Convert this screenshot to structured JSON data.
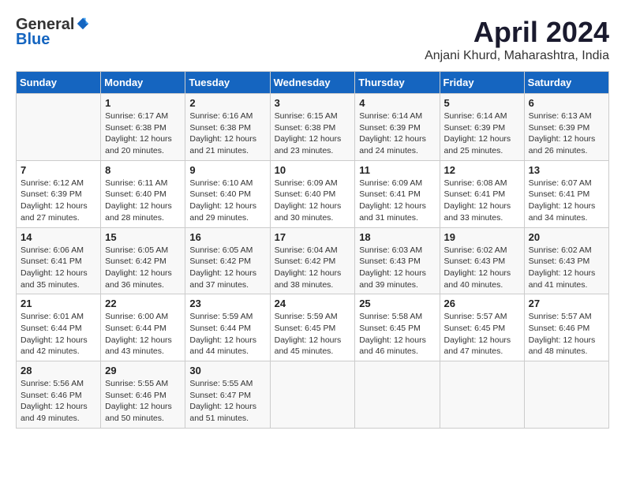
{
  "header": {
    "logo_general": "General",
    "logo_blue": "Blue",
    "title": "April 2024",
    "subtitle": "Anjani Khurd, Maharashtra, India"
  },
  "days_of_week": [
    "Sunday",
    "Monday",
    "Tuesday",
    "Wednesday",
    "Thursday",
    "Friday",
    "Saturday"
  ],
  "weeks": [
    [
      {
        "day": "",
        "content": ""
      },
      {
        "day": "1",
        "content": "Sunrise: 6:17 AM\nSunset: 6:38 PM\nDaylight: 12 hours\nand 20 minutes."
      },
      {
        "day": "2",
        "content": "Sunrise: 6:16 AM\nSunset: 6:38 PM\nDaylight: 12 hours\nand 21 minutes."
      },
      {
        "day": "3",
        "content": "Sunrise: 6:15 AM\nSunset: 6:38 PM\nDaylight: 12 hours\nand 23 minutes."
      },
      {
        "day": "4",
        "content": "Sunrise: 6:14 AM\nSunset: 6:39 PM\nDaylight: 12 hours\nand 24 minutes."
      },
      {
        "day": "5",
        "content": "Sunrise: 6:14 AM\nSunset: 6:39 PM\nDaylight: 12 hours\nand 25 minutes."
      },
      {
        "day": "6",
        "content": "Sunrise: 6:13 AM\nSunset: 6:39 PM\nDaylight: 12 hours\nand 26 minutes."
      }
    ],
    [
      {
        "day": "7",
        "content": "Sunrise: 6:12 AM\nSunset: 6:39 PM\nDaylight: 12 hours\nand 27 minutes."
      },
      {
        "day": "8",
        "content": "Sunrise: 6:11 AM\nSunset: 6:40 PM\nDaylight: 12 hours\nand 28 minutes."
      },
      {
        "day": "9",
        "content": "Sunrise: 6:10 AM\nSunset: 6:40 PM\nDaylight: 12 hours\nand 29 minutes."
      },
      {
        "day": "10",
        "content": "Sunrise: 6:09 AM\nSunset: 6:40 PM\nDaylight: 12 hours\nand 30 minutes."
      },
      {
        "day": "11",
        "content": "Sunrise: 6:09 AM\nSunset: 6:41 PM\nDaylight: 12 hours\nand 31 minutes."
      },
      {
        "day": "12",
        "content": "Sunrise: 6:08 AM\nSunset: 6:41 PM\nDaylight: 12 hours\nand 33 minutes."
      },
      {
        "day": "13",
        "content": "Sunrise: 6:07 AM\nSunset: 6:41 PM\nDaylight: 12 hours\nand 34 minutes."
      }
    ],
    [
      {
        "day": "14",
        "content": "Sunrise: 6:06 AM\nSunset: 6:41 PM\nDaylight: 12 hours\nand 35 minutes."
      },
      {
        "day": "15",
        "content": "Sunrise: 6:05 AM\nSunset: 6:42 PM\nDaylight: 12 hours\nand 36 minutes."
      },
      {
        "day": "16",
        "content": "Sunrise: 6:05 AM\nSunset: 6:42 PM\nDaylight: 12 hours\nand 37 minutes."
      },
      {
        "day": "17",
        "content": "Sunrise: 6:04 AM\nSunset: 6:42 PM\nDaylight: 12 hours\nand 38 minutes."
      },
      {
        "day": "18",
        "content": "Sunrise: 6:03 AM\nSunset: 6:43 PM\nDaylight: 12 hours\nand 39 minutes."
      },
      {
        "day": "19",
        "content": "Sunrise: 6:02 AM\nSunset: 6:43 PM\nDaylight: 12 hours\nand 40 minutes."
      },
      {
        "day": "20",
        "content": "Sunrise: 6:02 AM\nSunset: 6:43 PM\nDaylight: 12 hours\nand 41 minutes."
      }
    ],
    [
      {
        "day": "21",
        "content": "Sunrise: 6:01 AM\nSunset: 6:44 PM\nDaylight: 12 hours\nand 42 minutes."
      },
      {
        "day": "22",
        "content": "Sunrise: 6:00 AM\nSunset: 6:44 PM\nDaylight: 12 hours\nand 43 minutes."
      },
      {
        "day": "23",
        "content": "Sunrise: 5:59 AM\nSunset: 6:44 PM\nDaylight: 12 hours\nand 44 minutes."
      },
      {
        "day": "24",
        "content": "Sunrise: 5:59 AM\nSunset: 6:45 PM\nDaylight: 12 hours\nand 45 minutes."
      },
      {
        "day": "25",
        "content": "Sunrise: 5:58 AM\nSunset: 6:45 PM\nDaylight: 12 hours\nand 46 minutes."
      },
      {
        "day": "26",
        "content": "Sunrise: 5:57 AM\nSunset: 6:45 PM\nDaylight: 12 hours\nand 47 minutes."
      },
      {
        "day": "27",
        "content": "Sunrise: 5:57 AM\nSunset: 6:46 PM\nDaylight: 12 hours\nand 48 minutes."
      }
    ],
    [
      {
        "day": "28",
        "content": "Sunrise: 5:56 AM\nSunset: 6:46 PM\nDaylight: 12 hours\nand 49 minutes."
      },
      {
        "day": "29",
        "content": "Sunrise: 5:55 AM\nSunset: 6:46 PM\nDaylight: 12 hours\nand 50 minutes."
      },
      {
        "day": "30",
        "content": "Sunrise: 5:55 AM\nSunset: 6:47 PM\nDaylight: 12 hours\nand 51 minutes."
      },
      {
        "day": "",
        "content": ""
      },
      {
        "day": "",
        "content": ""
      },
      {
        "day": "",
        "content": ""
      },
      {
        "day": "",
        "content": ""
      }
    ]
  ]
}
